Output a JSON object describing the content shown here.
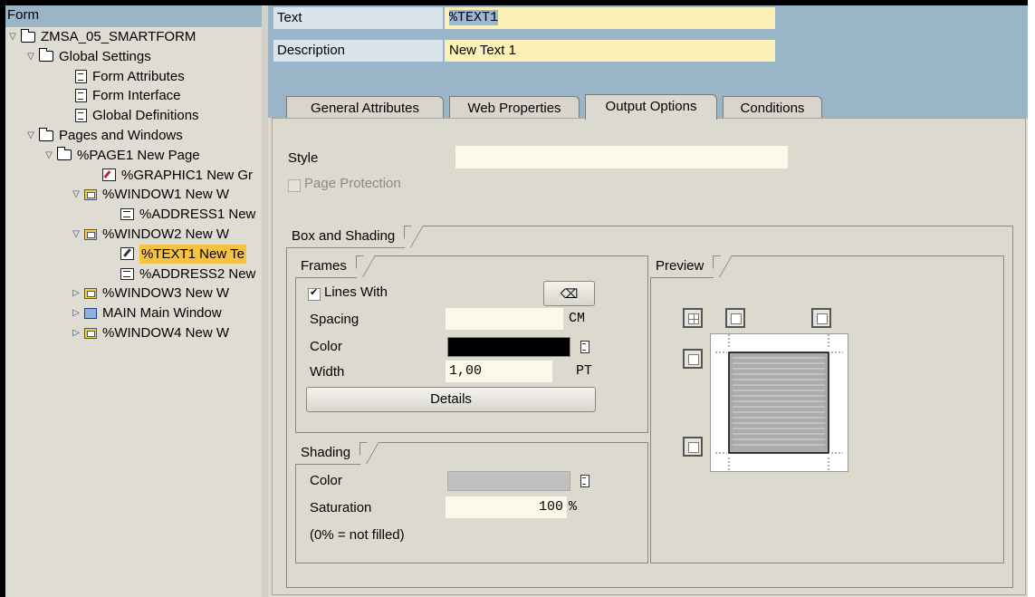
{
  "tree": {
    "header": "Form",
    "nodes": [
      {
        "label": "ZMSA_05_SMARTFORM",
        "twisty": "▽",
        "icon": "folder"
      },
      {
        "label": "Global Settings",
        "twisty": "▽",
        "icon": "folder"
      },
      {
        "label": "Form Attributes",
        "twisty": "",
        "icon": "doc"
      },
      {
        "label": "Form Interface",
        "twisty": "",
        "icon": "doc"
      },
      {
        "label": "Global Definitions",
        "twisty": "",
        "icon": "doc"
      },
      {
        "label": "Pages and Windows",
        "twisty": "▽",
        "icon": "folder"
      },
      {
        "label": "%PAGE1 New Page",
        "twisty": "▽",
        "icon": "folder"
      },
      {
        "label": "%GRAPHIC1 New Gr",
        "twisty": "",
        "icon": "graphic"
      },
      {
        "label": "%WINDOW1 New W",
        "twisty": "▽",
        "icon": "window"
      },
      {
        "label": "%ADDRESS1 New",
        "twisty": "",
        "icon": "addr"
      },
      {
        "label": "%WINDOW2 New W",
        "twisty": "▽",
        "icon": "window"
      },
      {
        "label": "%TEXT1 New Te",
        "twisty": "",
        "icon": "textnode",
        "selected": true
      },
      {
        "label": "%ADDRESS2 New",
        "twisty": "",
        "icon": "addr"
      },
      {
        "label": "%WINDOW3 New W",
        "twisty": "▷",
        "icon": "window"
      },
      {
        "label": "MAIN Main Window",
        "twisty": "▷",
        "icon": "main"
      },
      {
        "label": "%WINDOW4 New W",
        "twisty": "▷",
        "icon": "window"
      }
    ]
  },
  "header": {
    "text_label": "Text",
    "text_value": "%TEXT1",
    "description_label": "Description",
    "description_value": "New Text 1"
  },
  "tabs": [
    {
      "label": "General Attributes",
      "active": false
    },
    {
      "label": "Web Properties",
      "active": false
    },
    {
      "label": "Output Options",
      "active": true
    },
    {
      "label": "Conditions",
      "active": false
    }
  ],
  "output_options": {
    "style_label": "Style",
    "style_value": "",
    "page_protection_label": "Page Protection",
    "page_protection_checked": false
  },
  "box_and_shading": {
    "title": "Box and Shading",
    "frames": {
      "title": "Frames",
      "lines_with_label": "Lines With",
      "lines_with_checked": true,
      "spacing_label": "Spacing",
      "spacing_value": "",
      "spacing_unit": "CM",
      "color_label": "Color",
      "color_value": "#000000",
      "width_label": "Width",
      "width_value": "1,00",
      "width_unit": "PT",
      "details_button": "Details"
    },
    "shading": {
      "title": "Shading",
      "color_label": "Color",
      "color_value": "#c0c0c0",
      "saturation_label": "Saturation",
      "saturation_value": "100",
      "saturation_unit": "%",
      "note": "(0% = not filled)"
    },
    "preview": {
      "title": "Preview"
    }
  }
}
